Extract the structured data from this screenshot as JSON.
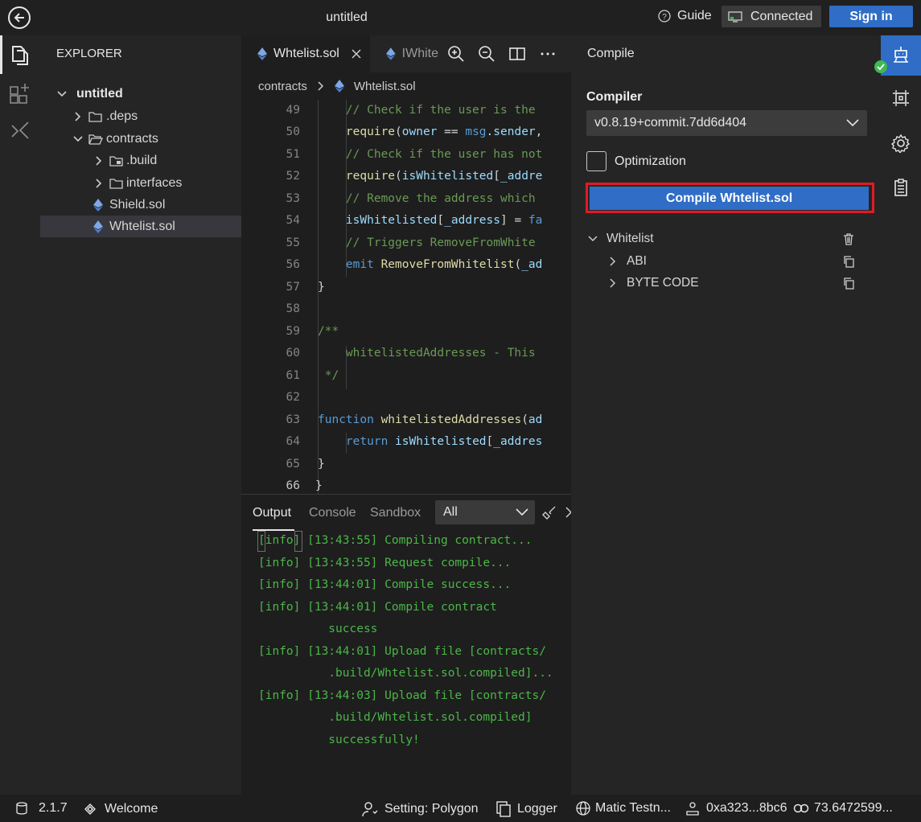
{
  "window": {
    "title": "untitled"
  },
  "titlebar": {
    "guide": "Guide",
    "connection_status": "Connected",
    "sign_in": "Sign in"
  },
  "explorer": {
    "title": "EXPLORER",
    "tree": [
      {
        "label": "untitled",
        "bold": true
      },
      {
        "label": ".deps"
      },
      {
        "label": "contracts"
      },
      {
        "label": ".build"
      },
      {
        "label": "interfaces"
      },
      {
        "label": "Shield.sol"
      },
      {
        "label": "Whtelist.sol",
        "selected": true
      }
    ]
  },
  "editor": {
    "tabs": [
      {
        "label": "Whtelist.sol",
        "active": true
      },
      {
        "label": "IWhite"
      }
    ],
    "breadcrumb": [
      "contracts",
      "Whtelist.sol"
    ],
    "lines": [
      {
        "n": "49",
        "text": "    // Check if the user is the"
      },
      {
        "n": "50",
        "text": "    require(owner == msg.sender,"
      },
      {
        "n": "51",
        "text": "    // Check if the user has not"
      },
      {
        "n": "52",
        "text": "    require(isWhitelisted[_addre"
      },
      {
        "n": "53",
        "text": "    // Remove the address which"
      },
      {
        "n": "54",
        "text": "    isWhitelisted[_address] = fa"
      },
      {
        "n": "55",
        "text": "    // Triggers RemoveFromWhite"
      },
      {
        "n": "56",
        "text": "    emit RemoveFromWhitelist(_ad"
      },
      {
        "n": "57",
        "text": "}"
      },
      {
        "n": "58",
        "text": ""
      },
      {
        "n": "59",
        "text": "/**"
      },
      {
        "n": "60",
        "text": "    whitelistedAddresses - This"
      },
      {
        "n": "61",
        "text": " */"
      },
      {
        "n": "62",
        "text": ""
      },
      {
        "n": "63",
        "text": "function whitelistedAddresses(ad"
      },
      {
        "n": "64",
        "text": "    return isWhitelisted[_addres"
      },
      {
        "n": "65",
        "text": "}"
      },
      {
        "n": "66",
        "text": "}"
      }
    ]
  },
  "panel": {
    "tabs": [
      "Output",
      "Console",
      "Sandbox"
    ],
    "filter": "All",
    "logs": [
      "[info] [13:43:55] Compiling contract...",
      "[info] [13:43:55] Request compile...",
      "[info] [13:44:01] Compile success...",
      "[info] [13:44:01] Compile contract",
      "          success",
      "[info] [13:44:01] Upload file [contracts/",
      "          .build/Whtelist.sol.compiled]...",
      "[info] [13:44:03] Upload file [contracts/",
      "          .build/Whtelist.sol.compiled]",
      "          successfully!"
    ]
  },
  "compile": {
    "title": "Compile",
    "compiler_label": "Compiler",
    "compiler_version": "v0.8.19+commit.7dd6d404",
    "optimization_label": "Optimization",
    "optimization_checked": false,
    "compile_button": "Compile Whtelist.sol",
    "contract": "Whitelist",
    "items": [
      "ABI",
      "BYTE CODE"
    ]
  },
  "statusbar": {
    "version": "2.1.7",
    "welcome": "Welcome",
    "setting": "Setting: Polygon",
    "logger": "Logger",
    "network": "Matic Testn...",
    "account": "0xa323...8bc6",
    "balance": "73.6472599..."
  },
  "colors": {
    "accent": "#2f6dc6",
    "highlight": "#e01b24",
    "log_green": "#4cb648",
    "success": "#3fb950"
  }
}
